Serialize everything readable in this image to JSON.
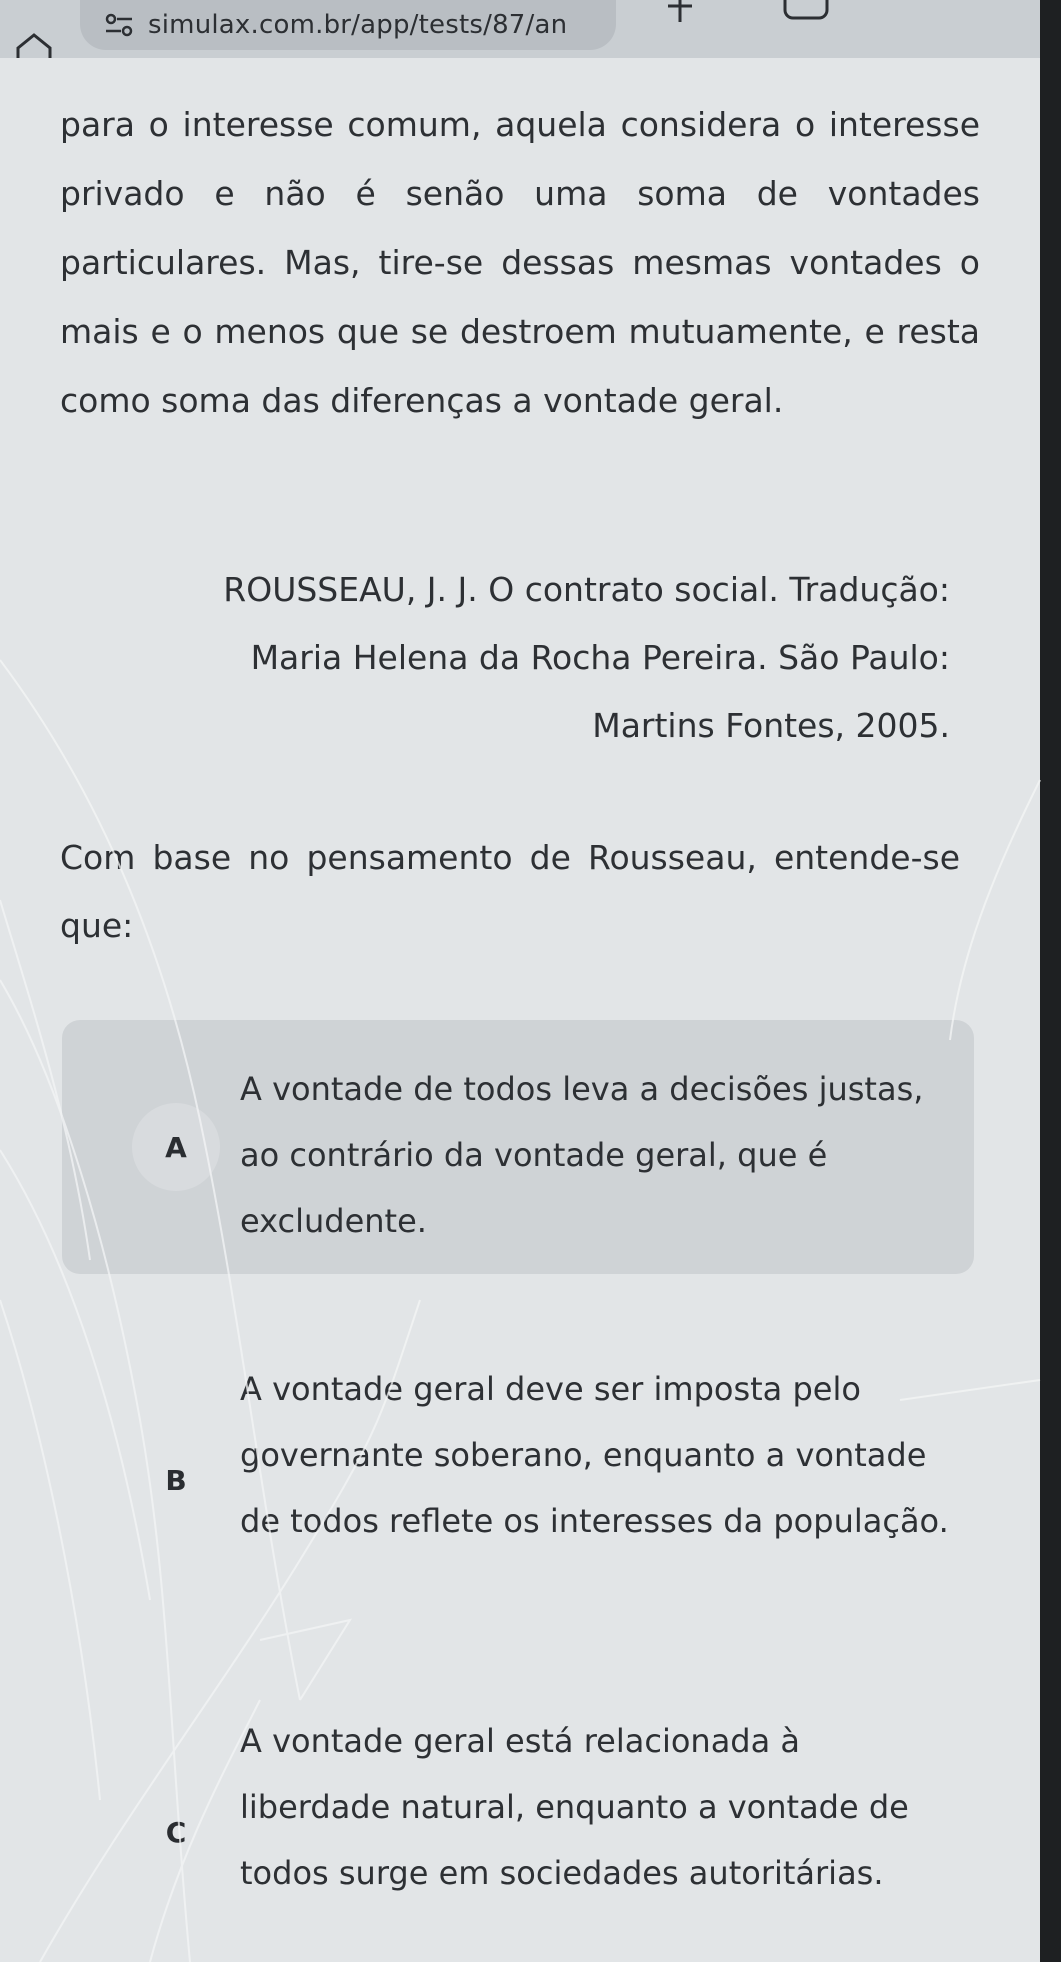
{
  "browser": {
    "url": "simulax.com.br/app/tests/87/an"
  },
  "passage": {
    "text": "para o interesse comum, aquela considera o interesse privado e não é senão uma soma de vontades particulares. Mas, tire-se dessas mesmas vontades o mais e o menos que se destroem mutuamente, e resta como soma das diferenças a vontade geral.",
    "citation_line1": "ROUSSEAU, J. J. O contrato social. Tradução:",
    "citation_line2": "Maria Helena da Rocha Pereira. São Paulo:",
    "citation_line3": "Martins Fontes, 2005."
  },
  "question": {
    "prompt": "Com base no pensamento de Rousseau, entende-se que:"
  },
  "options": [
    {
      "letter": "A",
      "text": "A vontade de todos leva a decisões justas, ao contrário da vontade geral, que é excludente.",
      "selected": true
    },
    {
      "letter": "B",
      "text": "A vontade geral deve ser imposta pelo governante soberano, enquanto a vontade de todos reflete os interesses da população.",
      "selected": false
    },
    {
      "letter": "C",
      "text": "A vontade geral está relacionada à liberdade natural, enquanto a vontade de todos surge em sociedades autoritárias.",
      "selected": false
    }
  ],
  "icons": {
    "home": "home-icon",
    "site_settings": "tune-icon",
    "new_tab": "plus-icon",
    "tabs": "tabs-icon"
  },
  "colors": {
    "selected_option_bg": "#cfd3d6",
    "text": "#2d3034"
  }
}
